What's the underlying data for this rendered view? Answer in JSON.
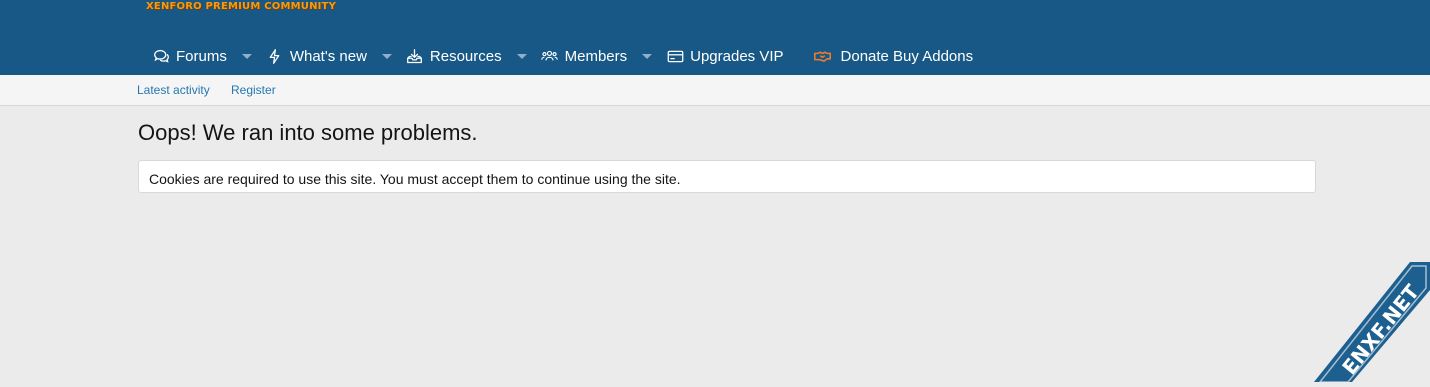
{
  "header": {
    "logo_text": "XENFORO PREMIUM COMMUNITY"
  },
  "nav": {
    "items": [
      {
        "label": "Forums",
        "icon": "comments-icon",
        "has_menu": true
      },
      {
        "label": "What's new",
        "icon": "bolt-icon",
        "has_menu": true
      },
      {
        "label": "Resources",
        "icon": "download-icon",
        "has_menu": true
      },
      {
        "label": "Members",
        "icon": "users-icon",
        "has_menu": true
      },
      {
        "label": "Upgrades VIP",
        "icon": "credit-card-icon",
        "has_menu": false
      },
      {
        "label": "Donate Buy Addons",
        "icon": "handshake-icon",
        "has_menu": false
      }
    ]
  },
  "subnav": {
    "latest_activity": "Latest activity",
    "register": "Register"
  },
  "main": {
    "title": "Oops! We ran into some problems.",
    "error_message": "Cookies are required to use this site. You must accept them to continue using the site."
  },
  "watermark": {
    "text": "ENXF.NET",
    "icon": "watermark-ribbon"
  },
  "colors": {
    "header_bg": "#185886",
    "subnav_bg": "#f5f5f5",
    "page_bg": "#ebebeb",
    "link": "#2577b1",
    "logo": "#f39c12",
    "donate_icon": "#f07c2a"
  }
}
